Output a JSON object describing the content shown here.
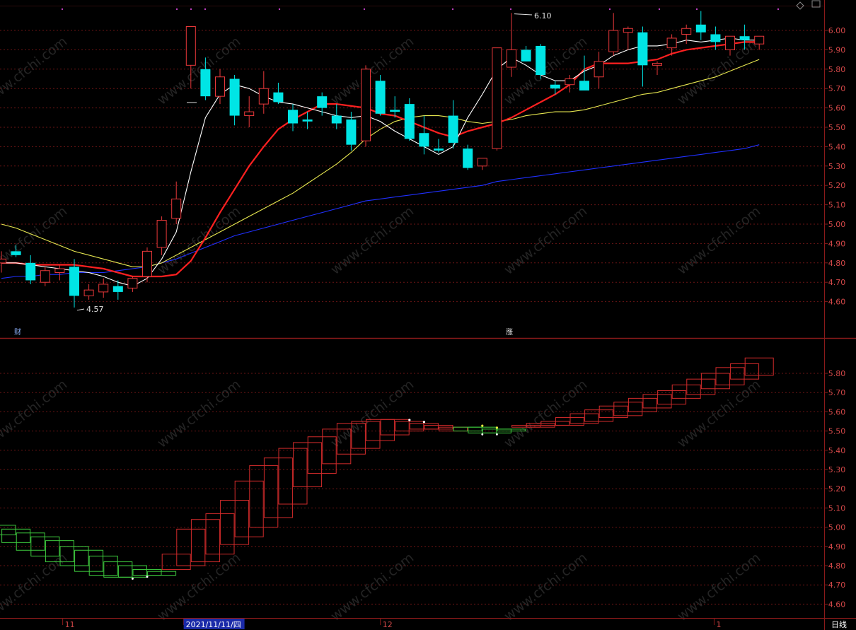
{
  "watermark": "www.cfchi.com",
  "period_label": "日线",
  "top_markers": {
    "left": "财",
    "right": "涨"
  },
  "colors": {
    "background": "#000000",
    "grid": "#6a1414",
    "frame": "#8a1a1a",
    "axis_text": "#d24848",
    "up": "#e8383a",
    "down": "#00e5e5",
    "ma5": "#ffffff",
    "ma10": "#ff2020",
    "ma20": "#e8e850",
    "ma60": "#2030ff",
    "box_up": "#d22b2b",
    "box_down": "#3ecc3e"
  },
  "annotations": {
    "high": "6.10",
    "low": "4.57"
  },
  "x_axis": {
    "labels": [
      "11",
      "2021/11/11/四",
      "12",
      "1"
    ]
  },
  "chart_data": [
    {
      "type": "candlestick",
      "panel": "price",
      "y_ticks": [
        4.6,
        4.7,
        4.8,
        4.9,
        5.0,
        5.1,
        5.2,
        5.3,
        5.4,
        5.5,
        5.6,
        5.7,
        5.8,
        5.9,
        6.0
      ],
      "ylim": [
        4.45,
        6.12
      ],
      "candles": [
        {
          "o": 4.8,
          "h": 4.86,
          "l": 4.75,
          "c": 4.82
        },
        {
          "o": 4.86,
          "h": 4.89,
          "l": 4.83,
          "c": 4.84
        },
        {
          "o": 4.8,
          "h": 4.84,
          "l": 4.69,
          "c": 4.71
        },
        {
          "o": 4.7,
          "h": 4.78,
          "l": 4.68,
          "c": 4.76
        },
        {
          "o": 4.75,
          "h": 4.79,
          "l": 4.71,
          "c": 4.77
        },
        {
          "o": 4.78,
          "h": 4.82,
          "l": 4.57,
          "c": 4.63
        },
        {
          "o": 4.63,
          "h": 4.69,
          "l": 4.61,
          "c": 4.66
        },
        {
          "o": 4.65,
          "h": 4.72,
          "l": 4.62,
          "c": 4.69
        },
        {
          "o": 4.68,
          "h": 4.71,
          "l": 4.61,
          "c": 4.65
        },
        {
          "o": 4.67,
          "h": 4.73,
          "l": 4.65,
          "c": 4.72
        },
        {
          "o": 4.73,
          "h": 4.88,
          "l": 4.7,
          "c": 4.86
        },
        {
          "o": 4.88,
          "h": 5.04,
          "l": 4.84,
          "c": 5.02
        },
        {
          "o": 5.03,
          "h": 5.22,
          "l": 5.0,
          "c": 5.13
        },
        {
          "o": 5.82,
          "h": 6.02,
          "l": 5.7,
          "c": 6.02
        },
        {
          "o": 5.8,
          "h": 5.86,
          "l": 5.64,
          "c": 5.66
        },
        {
          "o": 5.66,
          "h": 5.8,
          "l": 5.62,
          "c": 5.76
        },
        {
          "o": 5.75,
          "h": 5.77,
          "l": 5.51,
          "c": 5.56
        },
        {
          "o": 5.56,
          "h": 5.66,
          "l": 5.5,
          "c": 5.58
        },
        {
          "o": 5.62,
          "h": 5.79,
          "l": 5.57,
          "c": 5.7
        },
        {
          "o": 5.68,
          "h": 5.73,
          "l": 5.62,
          "c": 5.63
        },
        {
          "o": 5.59,
          "h": 5.62,
          "l": 5.48,
          "c": 5.52
        },
        {
          "o": 5.54,
          "h": 5.58,
          "l": 5.49,
          "c": 5.53
        },
        {
          "o": 5.66,
          "h": 5.68,
          "l": 5.56,
          "c": 5.6
        },
        {
          "o": 5.56,
          "h": 5.62,
          "l": 5.49,
          "c": 5.52
        },
        {
          "o": 5.54,
          "h": 5.58,
          "l": 5.38,
          "c": 5.41
        },
        {
          "o": 5.43,
          "h": 5.82,
          "l": 5.4,
          "c": 5.8
        },
        {
          "o": 5.74,
          "h": 5.77,
          "l": 5.56,
          "c": 5.57
        },
        {
          "o": 5.59,
          "h": 5.66,
          "l": 5.55,
          "c": 5.58
        },
        {
          "o": 5.62,
          "h": 5.65,
          "l": 5.43,
          "c": 5.44
        },
        {
          "o": 5.47,
          "h": 5.56,
          "l": 5.36,
          "c": 5.4
        },
        {
          "o": 5.39,
          "h": 5.44,
          "l": 5.37,
          "c": 5.38
        },
        {
          "o": 5.56,
          "h": 5.64,
          "l": 5.39,
          "c": 5.42
        },
        {
          "o": 5.39,
          "h": 5.41,
          "l": 5.28,
          "c": 5.29
        },
        {
          "o": 5.3,
          "h": 5.34,
          "l": 5.28,
          "c": 5.34
        },
        {
          "o": 5.39,
          "h": 5.91,
          "l": 5.38,
          "c": 5.91
        },
        {
          "o": 5.81,
          "h": 6.09,
          "l": 5.76,
          "c": 5.9
        },
        {
          "o": 5.9,
          "h": 5.92,
          "l": 5.84,
          "c": 5.84
        },
        {
          "o": 5.92,
          "h": 5.93,
          "l": 5.75,
          "c": 5.77
        },
        {
          "o": 5.72,
          "h": 5.74,
          "l": 5.67,
          "c": 5.7
        },
        {
          "o": 5.72,
          "h": 5.77,
          "l": 5.68,
          "c": 5.75
        },
        {
          "o": 5.74,
          "h": 5.87,
          "l": 5.7,
          "c": 5.69
        },
        {
          "o": 5.76,
          "h": 5.89,
          "l": 5.7,
          "c": 5.84
        },
        {
          "o": 5.89,
          "h": 6.09,
          "l": 5.87,
          "c": 6.0
        },
        {
          "o": 5.99,
          "h": 6.02,
          "l": 5.9,
          "c": 6.01
        },
        {
          "o": 5.99,
          "h": 6.02,
          "l": 5.71,
          "c": 5.82
        },
        {
          "o": 5.82,
          "h": 5.84,
          "l": 5.77,
          "c": 5.83
        },
        {
          "o": 5.91,
          "h": 5.98,
          "l": 5.87,
          "c": 5.96
        },
        {
          "o": 5.98,
          "h": 6.03,
          "l": 5.93,
          "c": 6.01
        },
        {
          "o": 6.03,
          "h": 6.1,
          "l": 5.95,
          "c": 5.99
        },
        {
          "o": 5.98,
          "h": 6.02,
          "l": 5.9,
          "c": 5.94
        },
        {
          "o": 5.9,
          "h": 5.95,
          "l": 5.87,
          "c": 5.97
        },
        {
          "o": 5.97,
          "h": 6.03,
          "l": 5.9,
          "c": 5.95
        },
        {
          "o": 5.93,
          "h": 5.97,
          "l": 5.9,
          "c": 5.97
        }
      ],
      "moving_averages": [
        {
          "name": "MA5",
          "color_key": "ma5",
          "values": [
            4.8,
            4.8,
            4.79,
            4.78,
            4.77,
            4.76,
            4.75,
            4.73,
            4.7,
            4.68,
            4.72,
            4.82,
            4.96,
            5.27,
            5.55,
            5.67,
            5.72,
            5.7,
            5.66,
            5.63,
            5.62,
            5.6,
            5.58,
            5.56,
            5.55,
            5.56,
            5.53,
            5.48,
            5.44,
            5.4,
            5.36,
            5.4,
            5.55,
            5.67,
            5.8,
            5.86,
            5.82,
            5.77,
            5.74,
            5.74,
            5.79,
            5.82,
            5.87,
            5.9,
            5.92,
            5.92,
            5.93,
            5.95,
            5.94,
            5.95,
            5.96,
            5.95,
            5.95
          ]
        },
        {
          "name": "MA10",
          "color_key": "ma10",
          "values": [
            4.8,
            4.8,
            4.79,
            4.79,
            4.79,
            4.79,
            4.78,
            4.77,
            4.75,
            4.73,
            4.73,
            4.73,
            4.74,
            4.81,
            4.93,
            5.06,
            5.18,
            5.3,
            5.4,
            5.49,
            5.54,
            5.58,
            5.62,
            5.62,
            5.61,
            5.6,
            5.57,
            5.56,
            5.53,
            5.5,
            5.47,
            5.45,
            5.48,
            5.5,
            5.52,
            5.55,
            5.59,
            5.63,
            5.67,
            5.72,
            5.8,
            5.83,
            5.83,
            5.83,
            5.84,
            5.85,
            5.88,
            5.9,
            5.91,
            5.92,
            5.93,
            5.94,
            5.94
          ]
        },
        {
          "name": "MA20",
          "color_key": "ma20",
          "values": [
            5.0,
            4.98,
            4.95,
            4.92,
            4.89,
            4.86,
            4.84,
            4.82,
            4.8,
            4.78,
            4.78,
            4.8,
            4.84,
            4.88,
            4.92,
            4.96,
            5.0,
            5.04,
            5.08,
            5.12,
            5.16,
            5.21,
            5.26,
            5.31,
            5.37,
            5.44,
            5.49,
            5.53,
            5.55,
            5.56,
            5.56,
            5.55,
            5.53,
            5.52,
            5.53,
            5.54,
            5.56,
            5.57,
            5.58,
            5.58,
            5.59,
            5.61,
            5.63,
            5.65,
            5.67,
            5.68,
            5.7,
            5.72,
            5.74,
            5.76,
            5.79,
            5.82,
            5.85
          ]
        },
        {
          "name": "MA60",
          "color_key": "ma60",
          "values": [
            4.72,
            4.73,
            4.73,
            4.74,
            4.74,
            4.75,
            4.75,
            4.75,
            4.76,
            4.77,
            4.78,
            4.8,
            4.82,
            4.85,
            4.88,
            4.91,
            4.94,
            4.96,
            4.98,
            5.0,
            5.02,
            5.04,
            5.06,
            5.08,
            5.1,
            5.12,
            5.13,
            5.14,
            5.15,
            5.16,
            5.17,
            5.18,
            5.19,
            5.2,
            5.22,
            5.23,
            5.24,
            5.25,
            5.26,
            5.27,
            5.28,
            5.29,
            5.3,
            5.31,
            5.32,
            5.33,
            5.34,
            5.35,
            5.36,
            5.37,
            5.38,
            5.39,
            5.41
          ]
        }
      ]
    },
    {
      "type": "box-trend",
      "panel": "indicator",
      "y_ticks": [
        4.6,
        4.7,
        4.8,
        4.9,
        5.0,
        5.1,
        5.2,
        5.3,
        5.4,
        5.5,
        5.6,
        5.7,
        5.8
      ],
      "ylim": [
        4.55,
        5.92
      ],
      "boxes": [
        {
          "top": 5.01,
          "bottom": 4.96,
          "dir": "down"
        },
        {
          "top": 4.99,
          "bottom": 4.92,
          "dir": "down"
        },
        {
          "top": 4.97,
          "bottom": 4.88,
          "dir": "down"
        },
        {
          "top": 4.95,
          "bottom": 4.85,
          "dir": "down"
        },
        {
          "top": 4.93,
          "bottom": 4.82,
          "dir": "down"
        },
        {
          "top": 4.9,
          "bottom": 4.8,
          "dir": "down"
        },
        {
          "top": 4.88,
          "bottom": 4.77,
          "dir": "down"
        },
        {
          "top": 4.85,
          "bottom": 4.75,
          "dir": "down"
        },
        {
          "top": 4.82,
          "bottom": 4.74,
          "dir": "down"
        },
        {
          "top": 4.8,
          "bottom": 4.74,
          "dir": "down"
        },
        {
          "top": 4.78,
          "bottom": 4.75,
          "dir": "down"
        },
        {
          "top": 4.77,
          "bottom": 4.75,
          "dir": "down"
        },
        {
          "top": 4.86,
          "bottom": 4.78,
          "dir": "up"
        },
        {
          "top": 4.99,
          "bottom": 4.8,
          "dir": "up"
        },
        {
          "top": 5.04,
          "bottom": 4.82,
          "dir": "up"
        },
        {
          "top": 5.07,
          "bottom": 4.86,
          "dir": "up"
        },
        {
          "top": 5.14,
          "bottom": 4.91,
          "dir": "up"
        },
        {
          "top": 5.24,
          "bottom": 4.95,
          "dir": "up"
        },
        {
          "top": 5.32,
          "bottom": 5.0,
          "dir": "up"
        },
        {
          "top": 5.36,
          "bottom": 5.05,
          "dir": "up"
        },
        {
          "top": 5.41,
          "bottom": 5.12,
          "dir": "up"
        },
        {
          "top": 5.44,
          "bottom": 5.21,
          "dir": "up"
        },
        {
          "top": 5.47,
          "bottom": 5.28,
          "dir": "up"
        },
        {
          "top": 5.51,
          "bottom": 5.33,
          "dir": "up"
        },
        {
          "top": 5.54,
          "bottom": 5.38,
          "dir": "up"
        },
        {
          "top": 5.55,
          "bottom": 5.41,
          "dir": "up"
        },
        {
          "top": 5.56,
          "bottom": 5.45,
          "dir": "up"
        },
        {
          "top": 5.56,
          "bottom": 5.48,
          "dir": "up"
        },
        {
          "top": 5.55,
          "bottom": 5.5,
          "dir": "up"
        },
        {
          "top": 5.54,
          "bottom": 5.51,
          "dir": "up"
        },
        {
          "top": 5.53,
          "bottom": 5.51,
          "dir": "up"
        },
        {
          "top": 5.52,
          "bottom": 5.5,
          "dir": "up"
        },
        {
          "top": 5.52,
          "bottom": 5.5,
          "dir": "down"
        },
        {
          "top": 5.52,
          "bottom": 5.49,
          "dir": "down"
        },
        {
          "top": 5.51,
          "bottom": 5.49,
          "dir": "down"
        },
        {
          "top": 5.51,
          "bottom": 5.5,
          "dir": "down"
        },
        {
          "top": 5.53,
          "bottom": 5.52,
          "dir": "up"
        },
        {
          "top": 5.54,
          "bottom": 5.52,
          "dir": "up"
        },
        {
          "top": 5.55,
          "bottom": 5.53,
          "dir": "up"
        },
        {
          "top": 5.57,
          "bottom": 5.53,
          "dir": "up"
        },
        {
          "top": 5.59,
          "bottom": 5.54,
          "dir": "up"
        },
        {
          "top": 5.61,
          "bottom": 5.55,
          "dir": "up"
        },
        {
          "top": 5.63,
          "bottom": 5.57,
          "dir": "up"
        },
        {
          "top": 5.65,
          "bottom": 5.58,
          "dir": "up"
        },
        {
          "top": 5.67,
          "bottom": 5.6,
          "dir": "up"
        },
        {
          "top": 5.69,
          "bottom": 5.62,
          "dir": "up"
        },
        {
          "top": 5.71,
          "bottom": 5.64,
          "dir": "up"
        },
        {
          "top": 5.74,
          "bottom": 5.67,
          "dir": "up"
        },
        {
          "top": 5.77,
          "bottom": 5.69,
          "dir": "up"
        },
        {
          "top": 5.8,
          "bottom": 5.72,
          "dir": "up"
        },
        {
          "top": 5.83,
          "bottom": 5.74,
          "dir": "up"
        },
        {
          "top": 5.85,
          "bottom": 5.77,
          "dir": "up"
        },
        {
          "top": 5.88,
          "bottom": 5.79,
          "dir": "up"
        }
      ]
    }
  ]
}
